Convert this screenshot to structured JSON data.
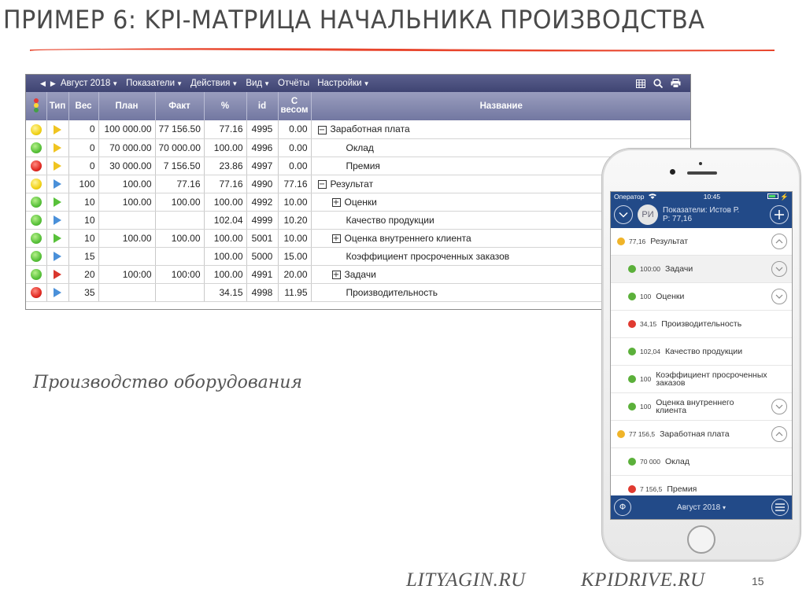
{
  "slide": {
    "title": "ПРИМЕР 6: KPI-МАТРИЦА НАЧАЛЬНИКА ПРОИЗВОДСТВА",
    "caption": "Производство оборудования",
    "links": [
      "LITYAGIN.RU",
      "KPIDRIVE.RU"
    ],
    "page_number": "15",
    "accent_color": "#e8452c"
  },
  "desktop": {
    "toolbar": {
      "period": "Август 2018",
      "menus": [
        "Показатели",
        "Действия",
        "Вид",
        "Отчёты",
        "Настройки"
      ],
      "icons": [
        "grid-icon",
        "search-icon",
        "print-icon"
      ]
    },
    "columns": [
      "Тип",
      "Вес",
      "План",
      "Факт",
      "%",
      "id",
      "С весом",
      "Название"
    ],
    "rows": [
      {
        "status": "yellow",
        "type": "yellow",
        "weight": "0",
        "plan": "100 000.00",
        "fact": "77 156.50",
        "pct": "77.16",
        "id": "4995",
        "weighted": "0.00",
        "name": "Заработная плата",
        "level": 0,
        "expander": "minus"
      },
      {
        "status": "green",
        "type": "yellow",
        "weight": "0",
        "plan": "70 000.00",
        "fact": "70 000.00",
        "pct": "100.00",
        "id": "4996",
        "weighted": "0.00",
        "name": "Оклад",
        "level": 2,
        "expander": ""
      },
      {
        "status": "red",
        "type": "yellow",
        "weight": "0",
        "plan": "30 000.00",
        "fact": "7 156.50",
        "pct": "23.86",
        "id": "4997",
        "weighted": "0.00",
        "name": "Премия",
        "level": 2,
        "expander": ""
      },
      {
        "status": "yellow",
        "type": "blue",
        "weight": "100",
        "plan": "100.00",
        "fact": "77.16",
        "pct": "77.16",
        "id": "4990",
        "weighted": "77.16",
        "name": "Результат",
        "level": 0,
        "expander": "minus"
      },
      {
        "status": "green",
        "type": "green",
        "weight": "10",
        "plan": "100.00",
        "fact": "100.00",
        "pct": "100.00",
        "id": "4992",
        "weighted": "10.00",
        "name": "Оценки",
        "level": 1,
        "expander": "plus"
      },
      {
        "status": "green",
        "type": "blue",
        "weight": "10",
        "plan": "",
        "fact": "",
        "pct": "102.04",
        "id": "4999",
        "weighted": "10.20",
        "name": "Качество продукции",
        "level": 2,
        "expander": ""
      },
      {
        "status": "green",
        "type": "green",
        "weight": "10",
        "plan": "100.00",
        "fact": "100.00",
        "pct": "100.00",
        "id": "5001",
        "weighted": "10.00",
        "name": "Оценка внутреннего клиента",
        "level": 1,
        "expander": "plus"
      },
      {
        "status": "green",
        "type": "blue",
        "weight": "15",
        "plan": "",
        "fact": "",
        "pct": "100.00",
        "id": "5000",
        "weighted": "15.00",
        "name": "Коэффициент просроченных заказов",
        "level": 2,
        "expander": ""
      },
      {
        "status": "green",
        "type": "red",
        "weight": "20",
        "plan": "100:00",
        "fact": "100:00",
        "pct": "100.00",
        "id": "4991",
        "weighted": "20.00",
        "name": "Задачи",
        "level": 1,
        "expander": "plus"
      },
      {
        "status": "red",
        "type": "blue",
        "weight": "35",
        "plan": "",
        "fact": "",
        "pct": "34.15",
        "id": "4998",
        "weighted": "11.95",
        "name": "Производительность",
        "level": 2,
        "expander": ""
      }
    ]
  },
  "mobile": {
    "status_bar": {
      "carrier": "Оператор",
      "time": "10:45"
    },
    "header": {
      "avatar_initials": "РИ",
      "line1": "Показатели: Истов Р.",
      "line2": "Р: 77,16"
    },
    "rows": [
      {
        "color": "#f0b429",
        "value": "77,16",
        "name": "Результат",
        "level": 0,
        "toggle": "up",
        "shaded": false
      },
      {
        "color": "#5bb03a",
        "value": "100:00",
        "name": "Задачи",
        "level": 1,
        "toggle": "down",
        "shaded": true
      },
      {
        "color": "#5bb03a",
        "value": "100",
        "name": "Оценки",
        "level": 1,
        "toggle": "down",
        "shaded": false
      },
      {
        "color": "#e03a30",
        "value": "34,15",
        "name": "Производительность",
        "level": 1,
        "toggle": "",
        "shaded": false
      },
      {
        "color": "#5bb03a",
        "value": "102,04",
        "name": "Качество продукции",
        "level": 1,
        "toggle": "",
        "shaded": false
      },
      {
        "color": "#5bb03a",
        "value": "100",
        "name": "Коэффициент просроченных заказов",
        "level": 1,
        "toggle": "",
        "shaded": false
      },
      {
        "color": "#5bb03a",
        "value": "100",
        "name": "Оценка внутреннего клиента",
        "level": 1,
        "toggle": "down",
        "shaded": false
      },
      {
        "color": "#f0b429",
        "value": "77 156,5",
        "name": "Заработная плата",
        "level": 0,
        "toggle": "up",
        "shaded": false
      },
      {
        "color": "#5bb03a",
        "value": "70 000",
        "name": "Оклад",
        "level": 1,
        "toggle": "",
        "shaded": false
      },
      {
        "color": "#e03a30",
        "value": "7 156,5",
        "name": "Премия",
        "level": 1,
        "toggle": "",
        "shaded": false
      }
    ],
    "bottom_bar": {
      "period": "Август 2018"
    }
  }
}
